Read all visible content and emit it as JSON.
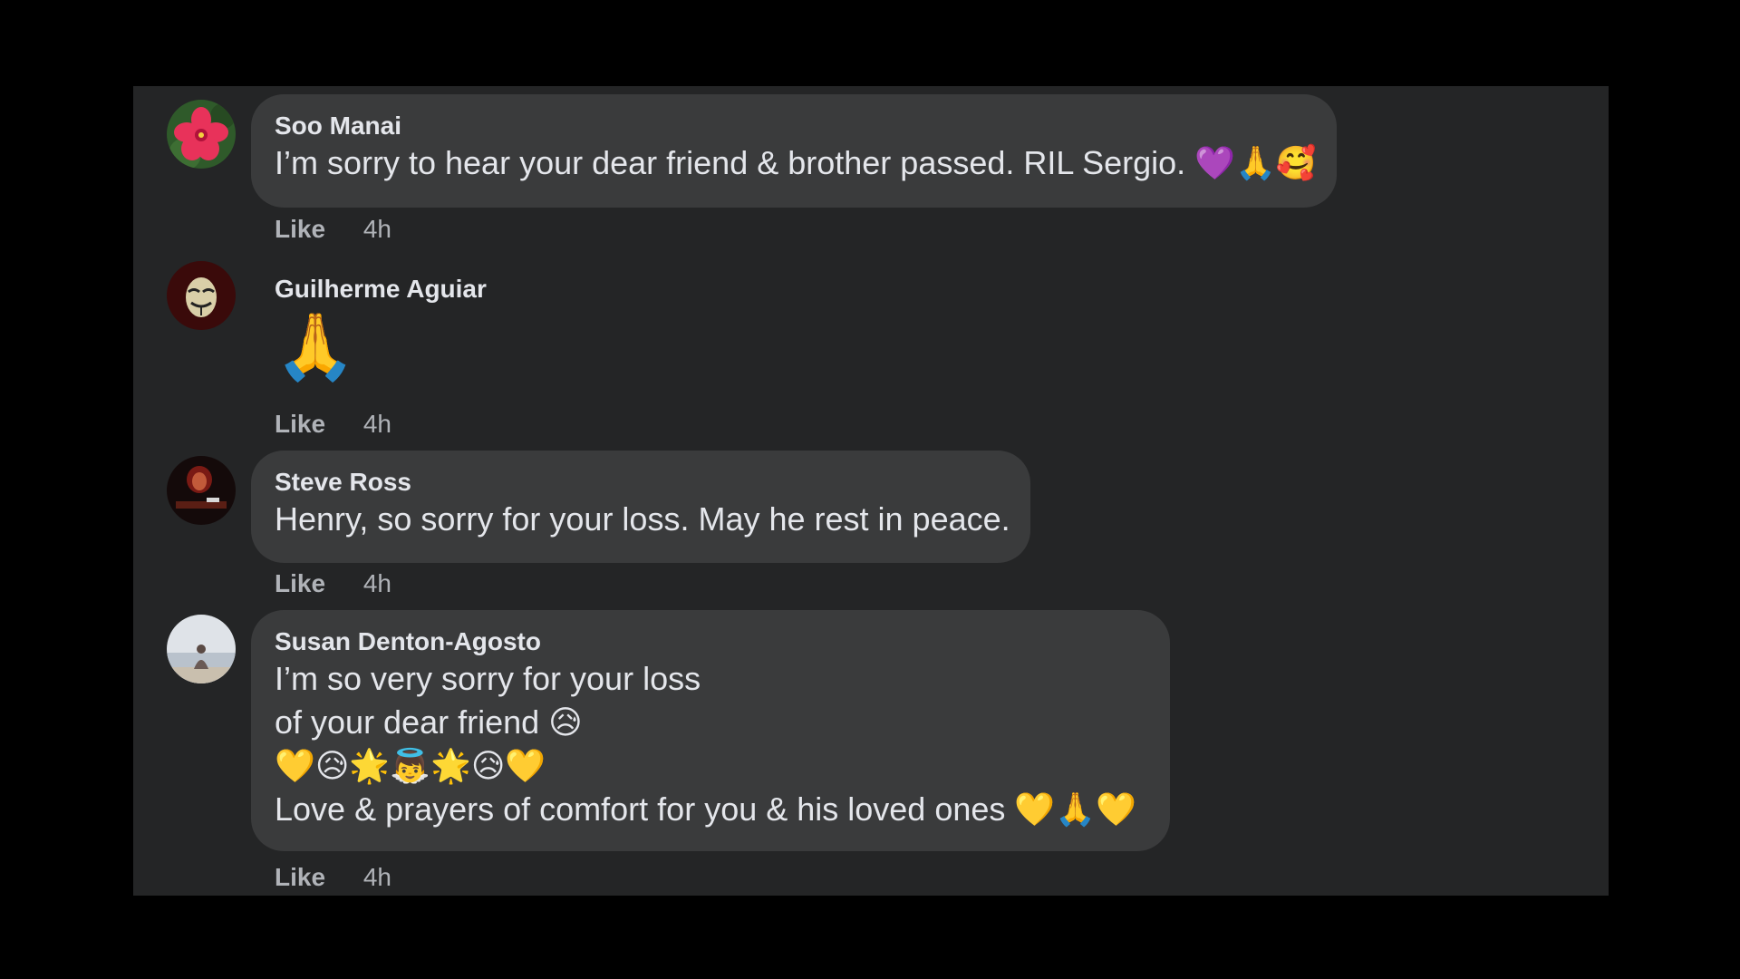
{
  "comments": [
    {
      "author": "Soo Manai",
      "lines": [
        "I’m sorry to hear your dear friend & brother passed. RIL Sergio. 💜🙏🥰"
      ],
      "like_label": "Like",
      "time": "4h",
      "avatar": "pink-hibiscus-flower"
    },
    {
      "author": "Guilherme Aguiar",
      "emoji": "🙏",
      "like_label": "Like",
      "time": "4h",
      "avatar": "masked-face"
    },
    {
      "author": "Steve Ross",
      "lines": [
        "Henry, so sorry for your loss. May he rest in peace."
      ],
      "like_label": "Like",
      "time": "4h",
      "avatar": "dark-red-logo"
    },
    {
      "author": "Susan Denton-Agosto",
      "lines": [
        "I’m so very sorry for your loss",
        "of your dear friend 😥",
        "💛😥🌟👼🌟😥💛",
        "Love & prayers of comfort for you & his loved ones 💛🙏💛"
      ],
      "like_label": "Like",
      "time": "4h",
      "avatar": "person-on-beach"
    }
  ]
}
